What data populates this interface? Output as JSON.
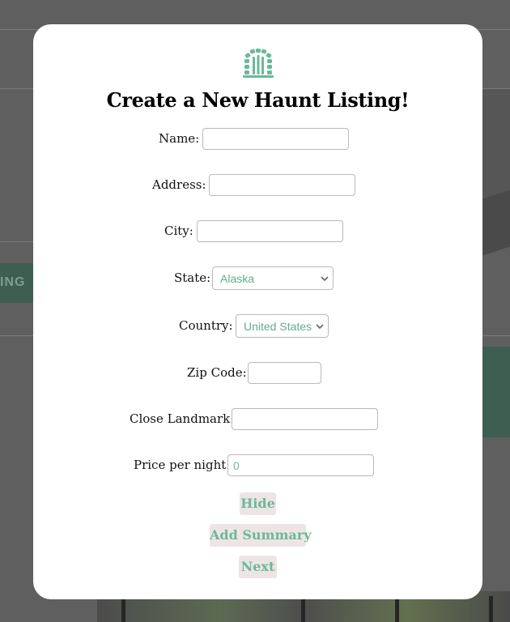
{
  "background": {
    "band_text": "ING"
  },
  "modal": {
    "logo_icon": "arched-gate-icon",
    "title": "Create a New Haunt Listing!",
    "fields": {
      "name": {
        "label": "Name:",
        "value": ""
      },
      "address": {
        "label": "Address:",
        "value": ""
      },
      "city": {
        "label": "City:",
        "value": ""
      },
      "state": {
        "label": "State:",
        "value": "Alaska"
      },
      "country": {
        "label": "Country:",
        "value": "United States"
      },
      "zip": {
        "label": "Zip Code:",
        "value": ""
      },
      "landmark": {
        "label": "Close Landmark:",
        "value": ""
      },
      "price": {
        "label": "Price per night:",
        "value": "0"
      }
    },
    "buttons": {
      "hide": "Hide",
      "add_summary": "Add Summary",
      "next": "Next"
    }
  },
  "colors": {
    "accent": "#6cb898",
    "button_bg": "#ede5e5",
    "overlay": "#5f5f5f"
  }
}
